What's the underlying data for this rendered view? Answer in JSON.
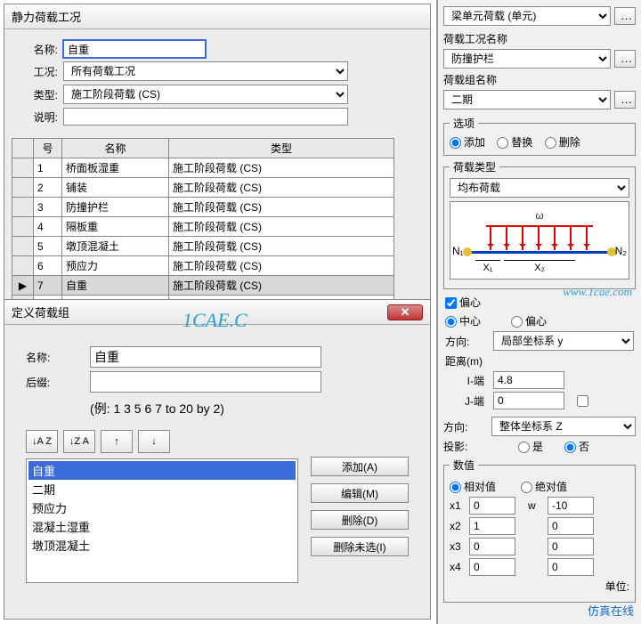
{
  "dlg1": {
    "title": "静力荷载工况",
    "labels": {
      "name": "名称:",
      "case": "工况:",
      "type": "类型:",
      "desc": "说明:"
    },
    "name_value": "自重",
    "case_value": "所有荷载工况",
    "type_value": "施工阶段荷载 (CS)",
    "desc_value": "",
    "table_headers": {
      "no": "号",
      "name": "名称",
      "type": "类型"
    },
    "rows": [
      {
        "no": "1",
        "name": "桥面板湿重",
        "type": "施工阶段荷载 (CS)"
      },
      {
        "no": "2",
        "name": "铺装",
        "type": "施工阶段荷载 (CS)"
      },
      {
        "no": "3",
        "name": "防撞护栏",
        "type": "施工阶段荷载 (CS)"
      },
      {
        "no": "4",
        "name": "隔板重",
        "type": "施工阶段荷载 (CS)"
      },
      {
        "no": "5",
        "name": "墩顶混凝土",
        "type": "施工阶段荷载 (CS)"
      },
      {
        "no": "6",
        "name": "预应力",
        "type": "施工阶段荷载 (CS)"
      },
      {
        "no": "7",
        "name": "自重",
        "type": "施工阶段荷载 (CS)"
      }
    ],
    "current_marker": "▶",
    "new_marker": "*"
  },
  "dlg2": {
    "title": "定义荷载组",
    "labels": {
      "name": "名称:",
      "suffix": "后缀:"
    },
    "name_value": "自重",
    "suffix_value": "",
    "example": "(例: 1 3 5 6 7 to 20 by 2)",
    "sort": {
      "az": "↓A Z",
      "za": "↓Z A",
      "up": "↑",
      "down": "↓"
    },
    "buttons": {
      "add": "添加(A)",
      "edit": "编辑(M)",
      "del": "删除(D)",
      "delun": "删除未选(I)"
    },
    "list": [
      "自重",
      "二期",
      "预应力",
      "混凝土湿重",
      "墩顶混凝土"
    ]
  },
  "right": {
    "top_select": "梁单元荷载 (单元)",
    "case_label": "荷载工况名称",
    "case_value": "防撞护栏",
    "group_label": "荷载组名称",
    "group_value": "二期",
    "options_legend": "选项",
    "options": {
      "add": "添加",
      "replace": "替换",
      "del": "删除"
    },
    "loadtype_legend": "荷载类型",
    "loadtype_value": "均布荷载",
    "diagram": {
      "w": "ω",
      "n1": "N₁",
      "n2": "N₂",
      "x1": "X₁",
      "x2": "X₂"
    },
    "ecc": {
      "check": "偏心",
      "center": "中心",
      "off": "偏心",
      "dir_label": "方向:",
      "dir_value": "局部坐标系 y",
      "dist_label": "距离(m)",
      "iend": "I-端",
      "iend_v": "4.8",
      "jend": "J-端",
      "jend_v": "0"
    },
    "dir2_label": "方向:",
    "dir2_value": "整体坐标系 Z",
    "proj_label": "投影:",
    "proj_yes": "是",
    "proj_no": "否",
    "value_legend": "数值",
    "rel": "相对值",
    "abs": "绝对值",
    "coords": {
      "x1": "x1",
      "x1v": "0",
      "w": "w",
      "wv": "-10",
      "x2": "x2",
      "x2v": "1",
      "x2w": "0",
      "x3": "x3",
      "x3v": "0",
      "x3w": "0",
      "x4": "x4",
      "x4v": "0",
      "x4w": "0"
    },
    "unit_label": "单位:"
  },
  "watermarks": {
    "w1": "1CAE.C",
    "url": "www.1cae.com"
  },
  "brand": "仿真在线"
}
